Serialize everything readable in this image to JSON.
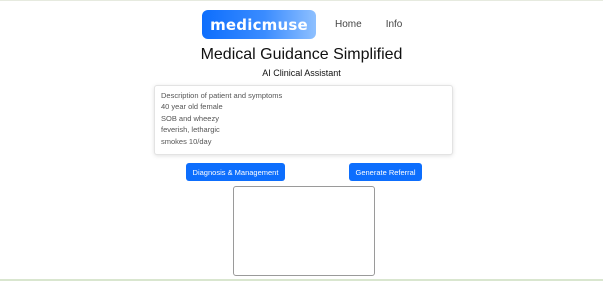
{
  "nav": {
    "logo": "medicmuse",
    "links": [
      "Home",
      "Info"
    ]
  },
  "hero": {
    "title": "Medical Guidance Simplified",
    "subtitle": "AI Clinical Assistant"
  },
  "input": {
    "lines": [
      "Description of patient and symptoms",
      "40 year old female",
      "SOB and wheezy",
      "feverish, lethargic",
      "smokes 10/day"
    ]
  },
  "actions": {
    "diagnosis_label": "Diagnosis & Management",
    "referral_label": "Generate Referral"
  },
  "output": {
    "value": ""
  },
  "colors": {
    "primary": "#0d6efd",
    "logo_gradient_end": "#8ec0ff"
  }
}
